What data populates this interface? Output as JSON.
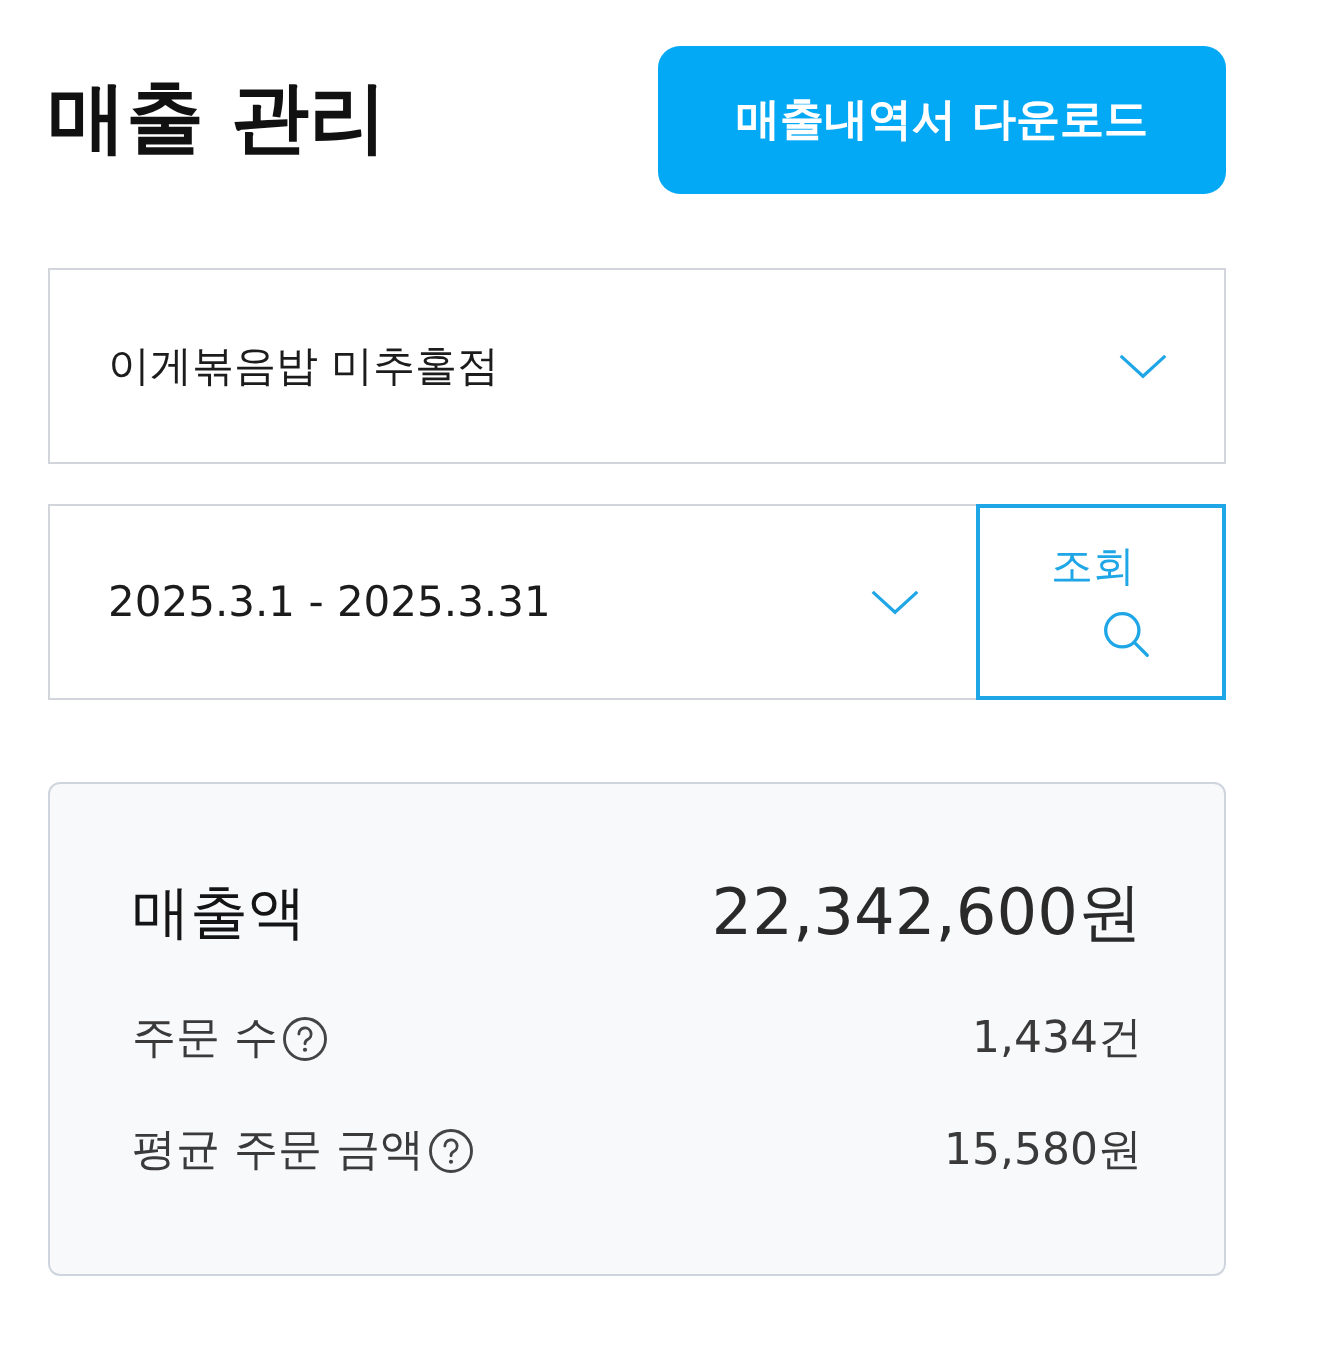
{
  "header": {
    "title": "매출 관리",
    "download_button": "매출내역서 다운로드"
  },
  "store_select": {
    "value": "이게볶음밥 미추홀점"
  },
  "date_range": {
    "value": "2025.3.1 - 2025.3.31"
  },
  "search_button": {
    "label": "조회"
  },
  "summary": {
    "rows": [
      {
        "kind": "primary",
        "label": "매출액",
        "value": "22,342,600원",
        "help": false
      },
      {
        "kind": "secondary",
        "label": "주문 수",
        "value": "1,434건",
        "help": true
      },
      {
        "kind": "secondary",
        "label": "평균 주문 금액",
        "value": "15,580원",
        "help": true
      }
    ]
  }
}
